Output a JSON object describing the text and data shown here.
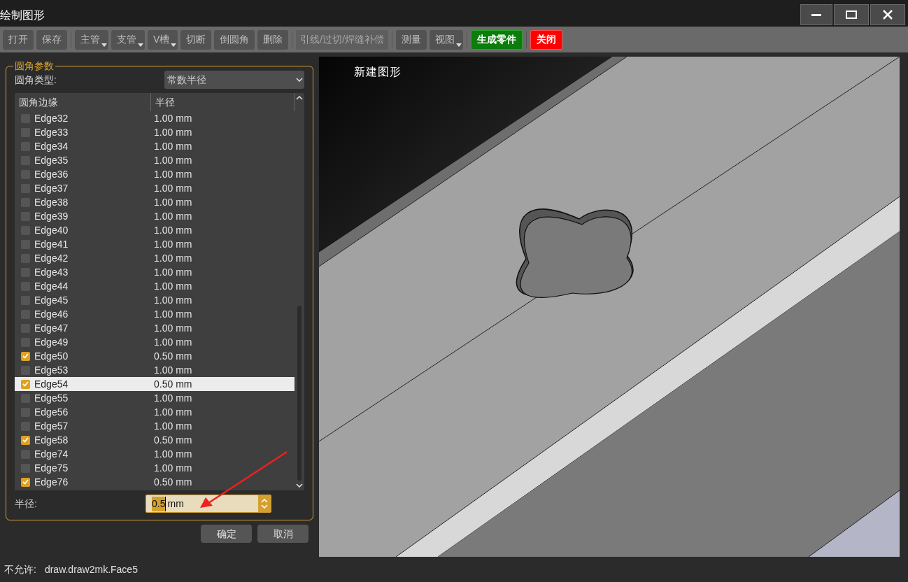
{
  "window": {
    "title": "绘制图形"
  },
  "toolbar": [
    {
      "label": "打开",
      "kind": "plain"
    },
    {
      "label": "保存",
      "kind": "plain"
    },
    {
      "kind": "separator"
    },
    {
      "label": "主管",
      "kind": "dropdown"
    },
    {
      "label": "支管",
      "kind": "dropdown"
    },
    {
      "label": "V槽",
      "kind": "dropdown"
    },
    {
      "label": "切断",
      "kind": "plain"
    },
    {
      "label": "倒圆角",
      "kind": "plain"
    },
    {
      "label": "删除",
      "kind": "plain"
    },
    {
      "kind": "separator"
    },
    {
      "label": "引线/过切/焊缝补偿",
      "kind": "disabled"
    },
    {
      "kind": "separator"
    },
    {
      "label": "测量",
      "kind": "plain"
    },
    {
      "label": "视图",
      "kind": "dropdown"
    },
    {
      "kind": "separator"
    },
    {
      "label": "生成零件",
      "kind": "green"
    },
    {
      "kind": "separator"
    },
    {
      "label": "关闭",
      "kind": "red"
    }
  ],
  "panel": {
    "title": "圆角参数",
    "type_label": "圆角类型:",
    "type_value": "常数半径",
    "columns": [
      "圆角边缘",
      "半径"
    ],
    "rows": [
      {
        "edge": "Edge32",
        "radius": "1.00 mm",
        "checked": false,
        "selected": false
      },
      {
        "edge": "Edge33",
        "radius": "1.00 mm",
        "checked": false,
        "selected": false
      },
      {
        "edge": "Edge34",
        "radius": "1.00 mm",
        "checked": false,
        "selected": false
      },
      {
        "edge": "Edge35",
        "radius": "1.00 mm",
        "checked": false,
        "selected": false
      },
      {
        "edge": "Edge36",
        "radius": "1.00 mm",
        "checked": false,
        "selected": false
      },
      {
        "edge": "Edge37",
        "radius": "1.00 mm",
        "checked": false,
        "selected": false
      },
      {
        "edge": "Edge38",
        "radius": "1.00 mm",
        "checked": false,
        "selected": false
      },
      {
        "edge": "Edge39",
        "radius": "1.00 mm",
        "checked": false,
        "selected": false
      },
      {
        "edge": "Edge40",
        "radius": "1.00 mm",
        "checked": false,
        "selected": false
      },
      {
        "edge": "Edge41",
        "radius": "1.00 mm",
        "checked": false,
        "selected": false
      },
      {
        "edge": "Edge42",
        "radius": "1.00 mm",
        "checked": false,
        "selected": false
      },
      {
        "edge": "Edge43",
        "radius": "1.00 mm",
        "checked": false,
        "selected": false
      },
      {
        "edge": "Edge44",
        "radius": "1.00 mm",
        "checked": false,
        "selected": false
      },
      {
        "edge": "Edge45",
        "radius": "1.00 mm",
        "checked": false,
        "selected": false
      },
      {
        "edge": "Edge46",
        "radius": "1.00 mm",
        "checked": false,
        "selected": false
      },
      {
        "edge": "Edge47",
        "radius": "1.00 mm",
        "checked": false,
        "selected": false
      },
      {
        "edge": "Edge49",
        "radius": "1.00 mm",
        "checked": false,
        "selected": false
      },
      {
        "edge": "Edge50",
        "radius": "0.50 mm",
        "checked": true,
        "selected": false
      },
      {
        "edge": "Edge53",
        "radius": "1.00 mm",
        "checked": false,
        "selected": false
      },
      {
        "edge": "Edge54",
        "radius": "0.50 mm",
        "checked": true,
        "selected": true
      },
      {
        "edge": "Edge55",
        "radius": "1.00 mm",
        "checked": false,
        "selected": false
      },
      {
        "edge": "Edge56",
        "radius": "1.00 mm",
        "checked": false,
        "selected": false
      },
      {
        "edge": "Edge57",
        "radius": "1.00 mm",
        "checked": false,
        "selected": false
      },
      {
        "edge": "Edge58",
        "radius": "0.50 mm",
        "checked": true,
        "selected": false
      },
      {
        "edge": "Edge74",
        "radius": "1.00 mm",
        "checked": false,
        "selected": false
      },
      {
        "edge": "Edge75",
        "radius": "1.00 mm",
        "checked": false,
        "selected": false
      },
      {
        "edge": "Edge76",
        "radius": "0.50 mm",
        "checked": true,
        "selected": false
      }
    ],
    "radius_label": "半径:",
    "radius_value": "0.5",
    "radius_unit": "mm"
  },
  "buttons": [
    "确定",
    "取消"
  ],
  "viewport": {
    "title": "新建图形"
  },
  "status_bar": {
    "label": "不允许:",
    "value": "draw.draw2mk.Face5"
  }
}
